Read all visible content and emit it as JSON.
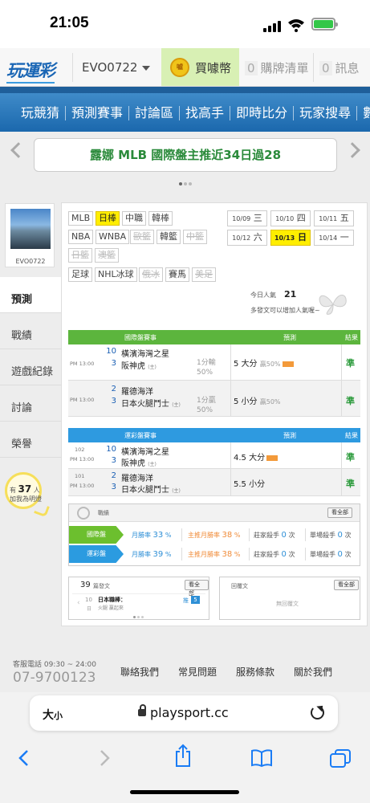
{
  "status_bar": {
    "time": "21:05"
  },
  "header": {
    "logo": "玩運彩",
    "username": "EVO0722",
    "coin_icon_text": "噓",
    "buy_coin": "買噱幣",
    "purchase_count": "0",
    "purchase_label": "購牌清單",
    "message_count": "0",
    "message_label": "訊息"
  },
  "nav": {
    "items": [
      "玩競猜",
      "預測賽事",
      "討論區",
      "找高手",
      "即時比分",
      "玩家搜尋",
      "數據"
    ]
  },
  "banner": {
    "text": "露娜 MLB 國際盤主推近34日過28"
  },
  "profile": {
    "name": "EVO0722"
  },
  "left_nav": [
    "預測",
    "戰績",
    "遊戲紀錄",
    "討論",
    "榮譽"
  ],
  "fans": {
    "prefix": "有",
    "count": "37",
    "suffix": "人",
    "line2": "加我為明燈"
  },
  "sports": [
    [
      "MLB",
      "日棒",
      "中職",
      "韓棒"
    ],
    [
      "NBA",
      "WNBA",
      "歐籃",
      "韓籃",
      "中籃"
    ],
    [
      "日籃",
      "澳籃"
    ],
    [
      "足球",
      "NHL冰球",
      "俄冰",
      "賽馬",
      "美足"
    ]
  ],
  "dates": [
    {
      "d": "10/09",
      "w": "三"
    },
    {
      "d": "10/10",
      "w": "四"
    },
    {
      "d": "10/11",
      "w": "五"
    },
    {
      "d": "10/12",
      "w": "六"
    },
    {
      "d": "10/13",
      "w": "日"
    },
    {
      "d": "10/14",
      "w": "一"
    }
  ],
  "popular": {
    "label": "今日人氣",
    "value": "21",
    "note": "多發文可以增加人氣喔~"
  },
  "intl_table": {
    "headers": [
      "國際盤賽事",
      "預測",
      "結果"
    ],
    "rows": [
      {
        "time": "PM 13:00",
        "n1": "10",
        "t1": "橫濱海灣之星",
        "n2": "3",
        "t2": "阪神虎",
        "home": "(主)",
        "line1": "1分輸",
        "line2": "50%",
        "pick": "5 大分",
        "pct": "贏50%",
        "result": "準"
      },
      {
        "time": "PM 13:00",
        "n1": "2",
        "t1": "羅德海洋",
        "n2": "3",
        "t2": "日本火腿鬥士",
        "home": "(主)",
        "line1": "1分贏",
        "line2": "50%",
        "pick": "5 小分",
        "pct": "贏50%",
        "result": "準"
      }
    ]
  },
  "sport_table": {
    "headers": [
      "運彩盤賽事",
      "預測",
      "結果"
    ],
    "rows": [
      {
        "code": "102",
        "time": "PM 13:00",
        "n1": "10",
        "t1": "橫濱海灣之星",
        "n2": "3",
        "t2": "阪神虎",
        "home": "(主)",
        "pick": "4.5 大分",
        "result": "準"
      },
      {
        "code": "101",
        "time": "PM 13:00",
        "n1": "2",
        "t1": "羅德海洋",
        "n2": "3",
        "t2": "日本火腿鬥士",
        "home": "(主)",
        "pick": "5.5 小分",
        "result": "準"
      }
    ]
  },
  "stats": {
    "title": "戰績",
    "view_all": "看全部",
    "rows": [
      {
        "label": "國際盤",
        "color": "#6cbf2e",
        "month_label": "月勝率",
        "month": "33",
        "main_label": "主推月勝率",
        "main": "38",
        "streak_label": "莊家殺手",
        "streak": "0",
        "single_label": "單場殺手",
        "single": "0",
        "pct": "%",
        "unit": "次"
      },
      {
        "label": "運彩盤",
        "color": "#2b9be0",
        "month_label": "月勝率",
        "month": "39",
        "main_label": "主推月勝率",
        "main": "38",
        "streak_label": "莊家殺手",
        "streak": "0",
        "single_label": "單場殺手",
        "single": "0",
        "pct": "%",
        "unit": "次"
      }
    ]
  },
  "posts": {
    "count": "39",
    "label": "篇發文",
    "view_all": "看全部",
    "item_day": "10",
    "item_unit": "日",
    "item_title": "日本職棒：",
    "item_sub": "火腿 贏起來",
    "push_label": "推",
    "push_count": "5"
  },
  "replies": {
    "label": "回覆文",
    "view_all": "看全部",
    "empty": "無回覆文"
  },
  "footer": {
    "service_label": "客服電話 09:30 ~ 24:00",
    "phone": "07-9700123",
    "links": [
      "聯絡我們",
      "常見問題",
      "服務條款",
      "關於我們"
    ]
  },
  "browser": {
    "text_size": "大",
    "text_size_small": "小",
    "url": "playsport.cc"
  }
}
